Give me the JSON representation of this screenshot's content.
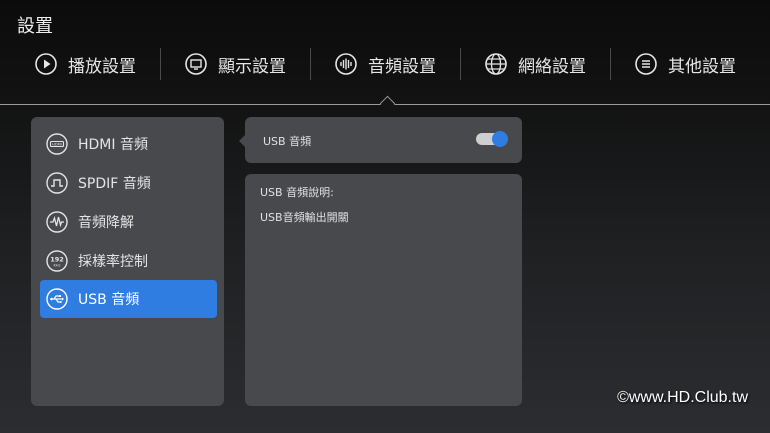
{
  "header": {
    "title": "設置"
  },
  "tabs": [
    {
      "label": "播放設置",
      "icon": "play-icon"
    },
    {
      "label": "顯示設置",
      "icon": "display-icon"
    },
    {
      "label": "音頻設置",
      "icon": "audio-wave-icon",
      "active": true
    },
    {
      "label": "網絡設置",
      "icon": "globe-icon"
    },
    {
      "label": "其他設置",
      "icon": "menu-icon"
    }
  ],
  "sidebar": {
    "items": [
      {
        "label": "HDMI 音頻",
        "icon": "hdmi-icon"
      },
      {
        "label": "SPDIF 音頻",
        "icon": "spdif-icon"
      },
      {
        "label": "音頻降解",
        "icon": "waveform-icon"
      },
      {
        "label": "採樣率控制",
        "icon": "sample-rate-192-icon",
        "icon_text_top": "192",
        "icon_text_bottom": "KHz"
      },
      {
        "label": "USB 音頻",
        "icon": "usb-icon",
        "active": true
      }
    ]
  },
  "usb_setting": {
    "label": "USB 音頻",
    "toggle_on": true
  },
  "description": {
    "title": "USB 音頻說明:",
    "body": "USB音頻輸出開關"
  },
  "watermark": "©www.HD.Club.tw",
  "colors": {
    "accent": "#2f7de1",
    "panel": "#47494c"
  }
}
